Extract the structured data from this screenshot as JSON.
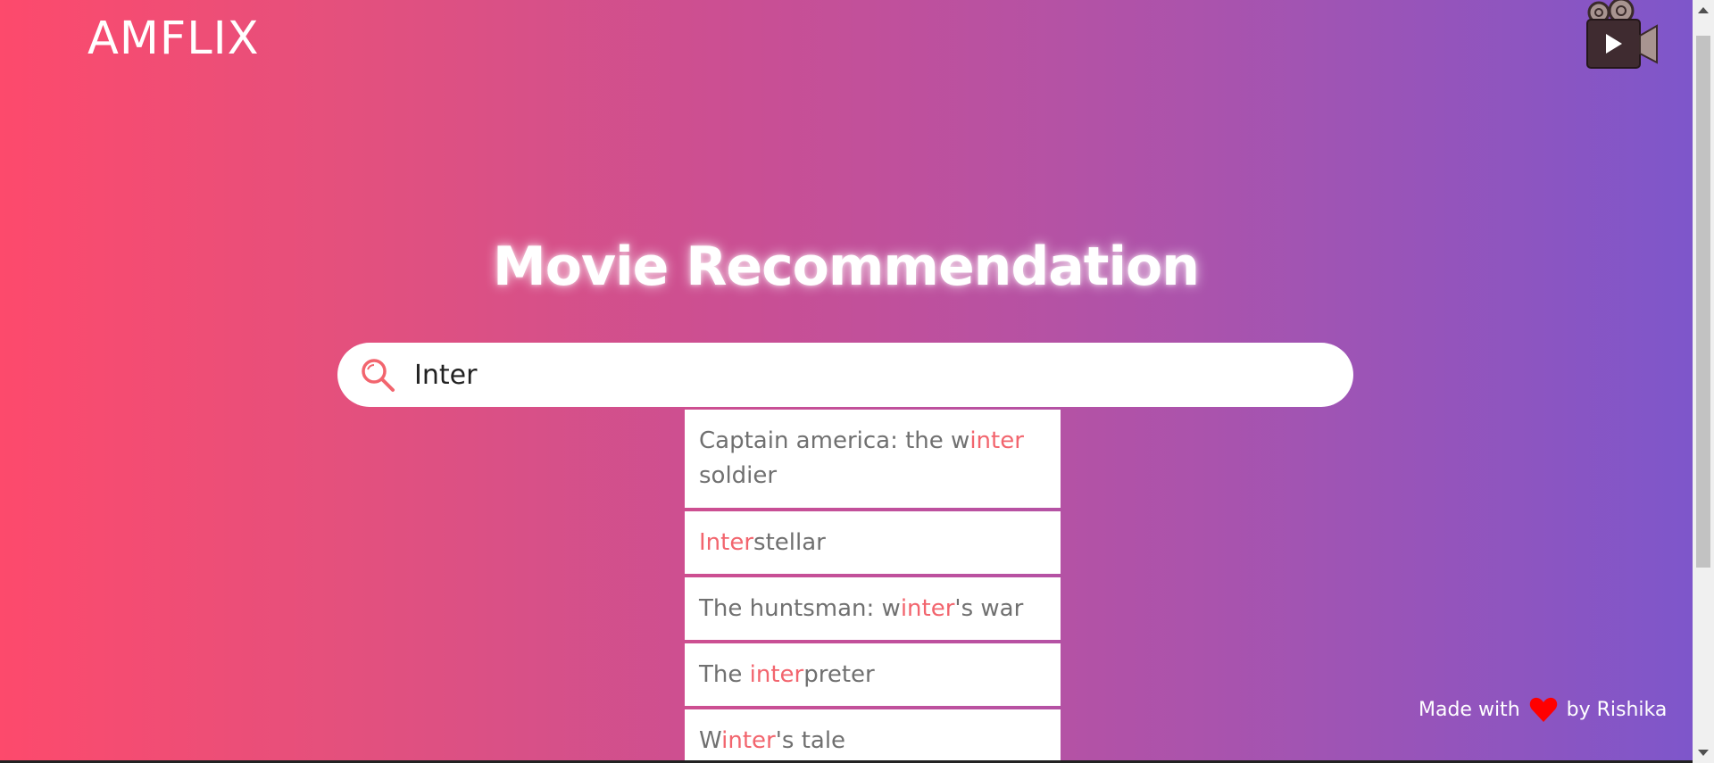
{
  "brand": {
    "name": "AMFLIX"
  },
  "hero": {
    "title": "Movie Recommendation"
  },
  "search": {
    "value": "Inter"
  },
  "suggestions": [
    {
      "pre": "Captain america: the w",
      "match": "inter",
      "post": "",
      "line2": "soldier"
    },
    {
      "pre": "",
      "match": "Inter",
      "post": "stellar"
    },
    {
      "pre": "The huntsman: w",
      "match": "inter",
      "post": "'s war"
    },
    {
      "pre": "The ",
      "match": "inter",
      "post": "preter"
    },
    {
      "pre": "W",
      "match": "inter",
      "post": "'s tale"
    }
  ],
  "footer": {
    "made_with": "Made with",
    "by": "by Rishika"
  },
  "colors": {
    "highlight": "#f2656e",
    "gradient_start": "#fd4a6c",
    "gradient_end": "#7c56cc",
    "heart": "#ff0000"
  },
  "icons": {
    "logo": "movie-camera-icon",
    "search": "search-icon",
    "footer": "heart-icon"
  }
}
